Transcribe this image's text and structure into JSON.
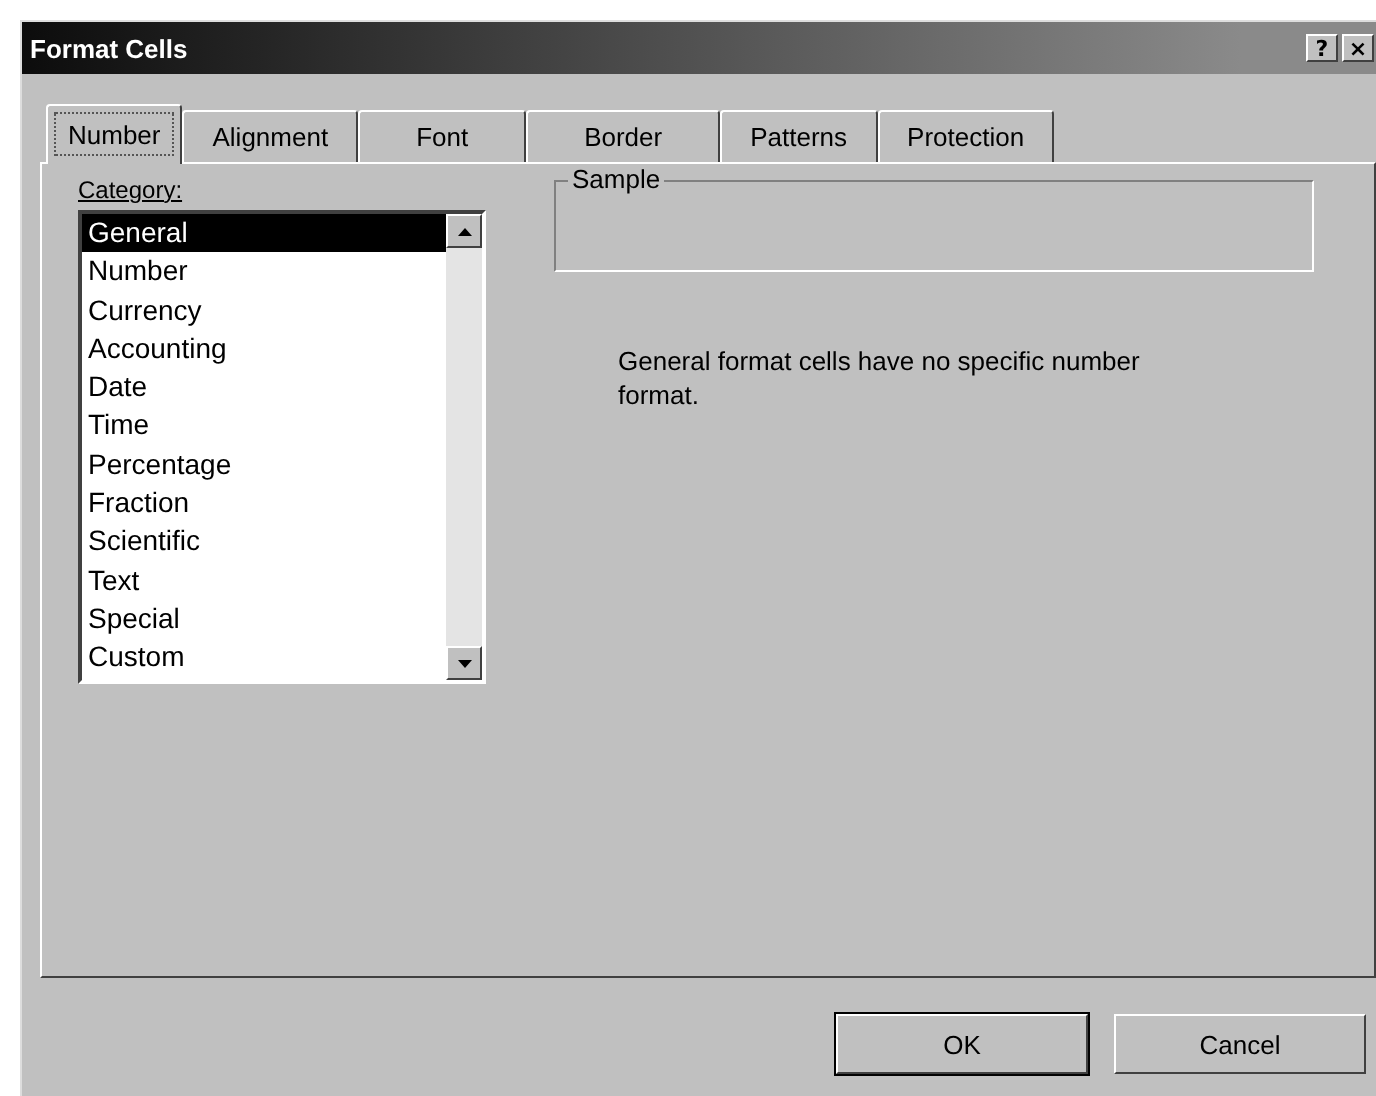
{
  "window": {
    "title": "Format Cells",
    "title_buttons": [
      "?",
      "×"
    ]
  },
  "tabs": [
    {
      "label": "Number",
      "selected": true
    },
    {
      "label": "Alignment",
      "selected": false
    },
    {
      "label": "Font",
      "selected": false
    },
    {
      "label": "Border",
      "selected": false
    },
    {
      "label": "Patterns",
      "selected": false
    },
    {
      "label": "Protection",
      "selected": false
    }
  ],
  "category": {
    "label": "Category:",
    "items": [
      {
        "label": "General",
        "selected": true
      },
      {
        "label": "Number",
        "selected": false
      },
      {
        "label": "Currency",
        "selected": false
      },
      {
        "label": "Accounting",
        "selected": false
      },
      {
        "label": "Date",
        "selected": false
      },
      {
        "label": "Time",
        "selected": false
      },
      {
        "label": "Percentage",
        "selected": false
      },
      {
        "label": "Fraction",
        "selected": false
      },
      {
        "label": "Scientific",
        "selected": false
      },
      {
        "label": "Text",
        "selected": false
      },
      {
        "label": "Special",
        "selected": false
      },
      {
        "label": "Custom",
        "selected": false
      }
    ]
  },
  "sample": {
    "label": "Sample"
  },
  "description": "General format cells have no specific number format.",
  "buttons": [
    "OK",
    "Cancel"
  ]
}
